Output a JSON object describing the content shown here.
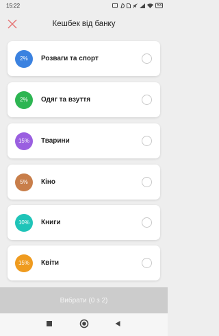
{
  "status_bar": {
    "time": "15:22",
    "battery": "53",
    "icons": [
      "screen-share-icon",
      "hangouts-icon",
      "sim-icon",
      "mute-icon",
      "signal-icon",
      "wifi-icon",
      "battery-icon"
    ]
  },
  "header": {
    "title": "Кешбек від банку",
    "close_icon": "close-icon",
    "accent_color": "#e57373"
  },
  "categories": [
    {
      "percent": "2%",
      "label": "Розваги та спорт",
      "color": "#3b82e0",
      "selected": false
    },
    {
      "percent": "2%",
      "label": "Одяг та взуття",
      "color": "#2db552",
      "selected": false
    },
    {
      "percent": "15%",
      "label": "Тварини",
      "color": "#9a5fe0",
      "selected": false
    },
    {
      "percent": "5%",
      "label": "Кіно",
      "color": "#c87e4a",
      "selected": false
    },
    {
      "percent": "10%",
      "label": "Книги",
      "color": "#1fc4b8",
      "selected": false
    },
    {
      "percent": "15%",
      "label": "Квіти",
      "color": "#ef9b1f",
      "selected": false
    }
  ],
  "select_button": {
    "label": "Вибрати (0 з 2)",
    "enabled": false
  },
  "nav": {
    "recents_icon": "square-icon",
    "home_icon": "circle-icon",
    "back_icon": "triangle-back-icon"
  }
}
